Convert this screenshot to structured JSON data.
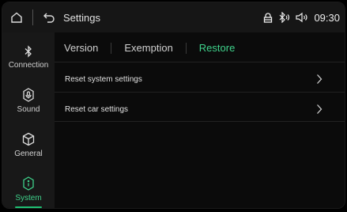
{
  "header": {
    "title": "Settings",
    "time": "09:30",
    "icons": [
      "home-icon",
      "back-icon",
      "lock-icon",
      "bluetooth-icon",
      "volume-icon"
    ]
  },
  "sidebar": {
    "items": [
      {
        "label": "Connection",
        "icon": "bluetooth-icon"
      },
      {
        "label": "Sound",
        "icon": "sound-icon"
      },
      {
        "label": "General",
        "icon": "cube-icon"
      },
      {
        "label": "System",
        "icon": "info-icon"
      }
    ],
    "active": "System"
  },
  "tabs": [
    {
      "label": "Version"
    },
    {
      "label": "Exemption"
    },
    {
      "label": "Restore"
    }
  ],
  "active_tab": "Restore",
  "rows": [
    {
      "label": "Reset system settings",
      "icon": "chevron-right-icon"
    },
    {
      "label": "Reset car settings",
      "icon": "chevron-right-icon"
    }
  ],
  "colors": {
    "accent": "#3fd28b",
    "background": "#0b0b0b",
    "sidebar": "#181818",
    "statusbar": "#161616"
  }
}
